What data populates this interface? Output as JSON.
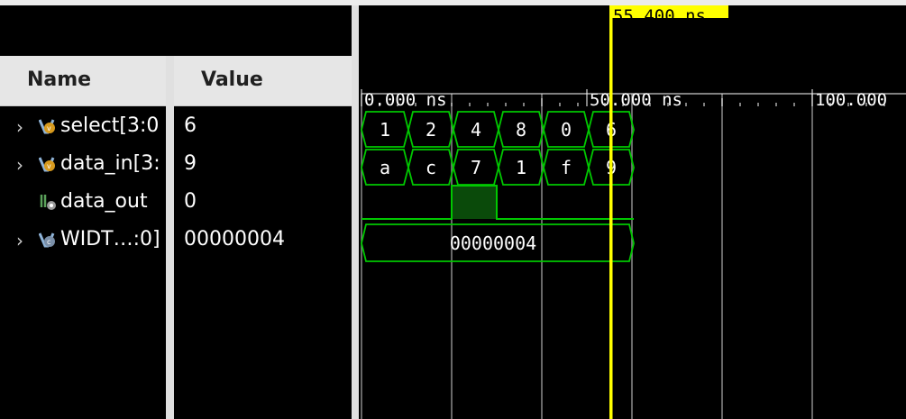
{
  "columns": {
    "name": "Name",
    "value": "Value"
  },
  "signals": [
    {
      "name": "select[3:0",
      "value": "6",
      "icon": "vector-icon",
      "expandable": true
    },
    {
      "name": "data_in[3:",
      "value": "9",
      "icon": "vector-icon",
      "expandable": true
    },
    {
      "name": "data_out",
      "value": "0",
      "icon": "bit-signal-icon",
      "expandable": false
    },
    {
      "name": "WIDT…:0]",
      "value": "00000004",
      "icon": "constant-icon",
      "expandable": true
    }
  ],
  "ruler": {
    "labels": [
      "0.000 ns",
      "50.000 ns",
      "100.000"
    ]
  },
  "cursor": {
    "label": "55.400 ns",
    "time_ns": 55.4,
    "color": "#ffff00"
  },
  "waveforms": {
    "select": [
      "1",
      "2",
      "4",
      "8",
      "0",
      "6"
    ],
    "data_in": [
      "a",
      "c",
      "7",
      "1",
      "f",
      "9"
    ],
    "data_out_high_index": 2,
    "width_value": "00000004"
  },
  "colors": {
    "wave": "#00c800",
    "background": "#000000",
    "grid": "#8a8a8a",
    "fill_high": "#0a4a0a"
  }
}
